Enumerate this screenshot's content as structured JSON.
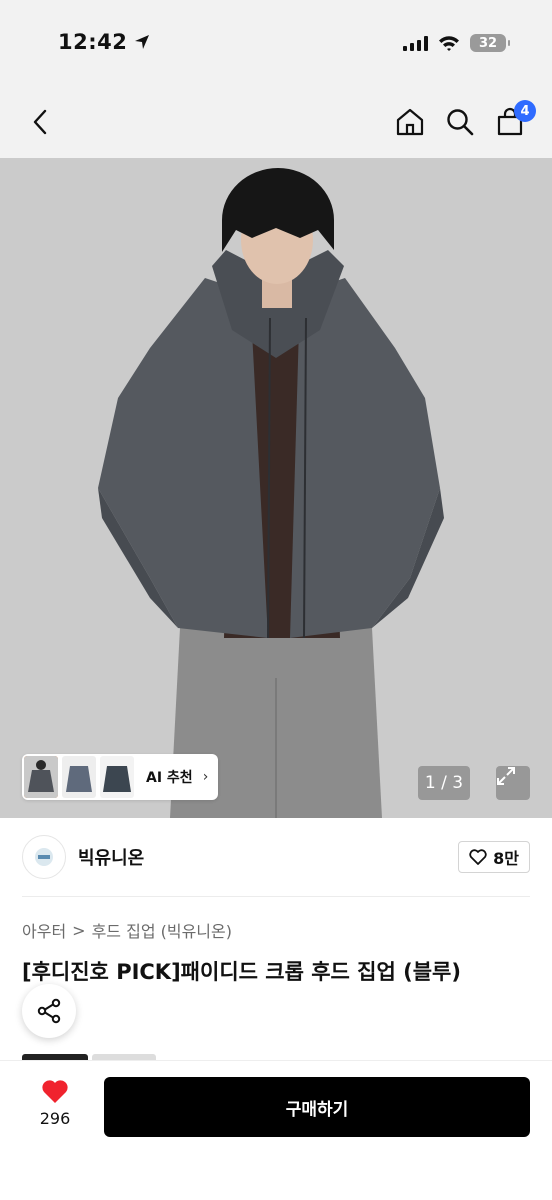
{
  "status_bar": {
    "time": "12:42",
    "battery": "32"
  },
  "nav": {
    "cart_count": "4"
  },
  "gallery": {
    "ai_label": "AI 추천",
    "page_indicator": "1 / 3"
  },
  "brand": {
    "name": "빅유니온",
    "like_count": "8만"
  },
  "breadcrumb": {
    "category": "아우터",
    "separator": ">",
    "subcategory": "후드 집업 (빅유니온)"
  },
  "product": {
    "title": "[후디진호 PICK]패이디드 크롭 후드 집업 (블루)"
  },
  "bottom_bar": {
    "wish_count": "296",
    "buy_label": "구매하기"
  },
  "colors": {
    "accent_blue": "#2f6bff",
    "heart_red": "#f0232e",
    "buy_button": "#000000"
  }
}
